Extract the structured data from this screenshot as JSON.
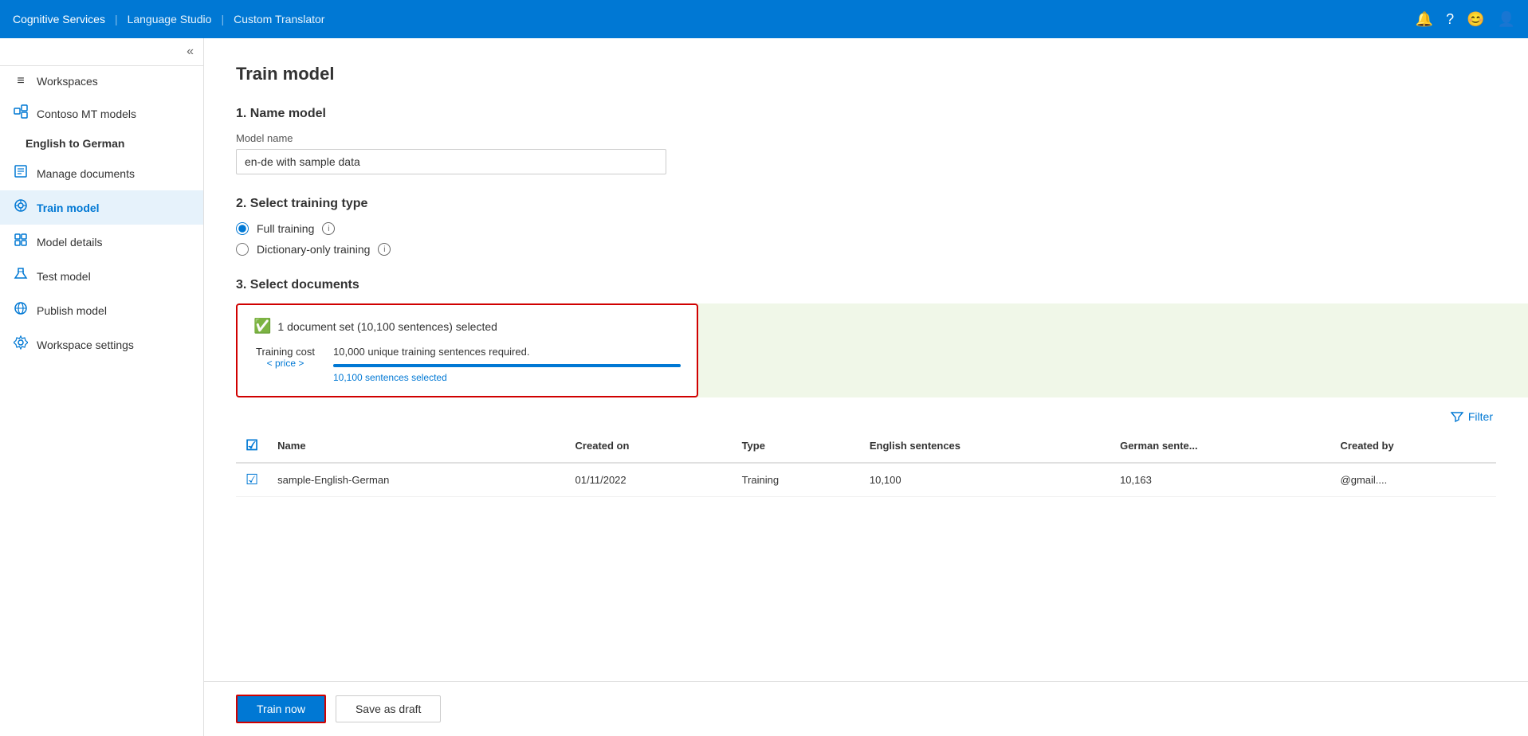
{
  "topbar": {
    "brand": "Cognitive Services",
    "sep1": "|",
    "link1": "Language Studio",
    "sep2": "|",
    "link2": "Custom Translator"
  },
  "sidebar": {
    "collapse_label": "«",
    "items": [
      {
        "id": "workspaces",
        "icon": "≡",
        "label": "Workspaces"
      },
      {
        "id": "contoso-mt",
        "icon": "👤",
        "label": "Contoso MT models"
      },
      {
        "id": "english-german",
        "label": "English to German",
        "sub": true
      },
      {
        "id": "manage-docs",
        "icon": "📄",
        "label": "Manage documents"
      },
      {
        "id": "train-model",
        "icon": "⚙",
        "label": "Train model",
        "active": true
      },
      {
        "id": "model-details",
        "icon": "🎲",
        "label": "Model details"
      },
      {
        "id": "test-model",
        "icon": "🔬",
        "label": "Test model"
      },
      {
        "id": "publish-model",
        "icon": "🌐",
        "label": "Publish model"
      },
      {
        "id": "workspace-settings",
        "icon": "⚙",
        "label": "Workspace settings"
      }
    ]
  },
  "page": {
    "title": "Train model",
    "section1_heading": "1. Name model",
    "model_name_label": "Model name",
    "model_name_value": "en-de with sample data",
    "section2_heading": "2. Select training type",
    "training_types": [
      {
        "id": "full",
        "label": "Full training",
        "checked": true
      },
      {
        "id": "dict",
        "label": "Dictionary-only training",
        "checked": false
      }
    ],
    "section3_heading": "3. Select documents",
    "doc_selection": {
      "status_text": "1 document set (10,100 sentences) selected",
      "cost_label_line1": "Training cost",
      "cost_label_line2": "< price >",
      "required_text": "10,000 unique training sentences required.",
      "progress_pct": 101,
      "sentences_selected": "10,100 sentences selected"
    },
    "filter_label": "Filter",
    "table": {
      "columns": [
        {
          "id": "check",
          "label": ""
        },
        {
          "id": "name",
          "label": "Name"
        },
        {
          "id": "created",
          "label": "Created on"
        },
        {
          "id": "type",
          "label": "Type"
        },
        {
          "id": "english",
          "label": "English sentences"
        },
        {
          "id": "german",
          "label": "German sente..."
        },
        {
          "id": "created_by",
          "label": "Created by"
        }
      ],
      "rows": [
        {
          "checked": true,
          "name": "sample-English-German",
          "created": "01/11/2022",
          "type": "Training",
          "english_sentences": "10,100",
          "german_sentences": "10,163",
          "created_by": "@gmail...."
        }
      ]
    }
  },
  "actions": {
    "train_now": "Train now",
    "save_draft": "Save as draft"
  }
}
